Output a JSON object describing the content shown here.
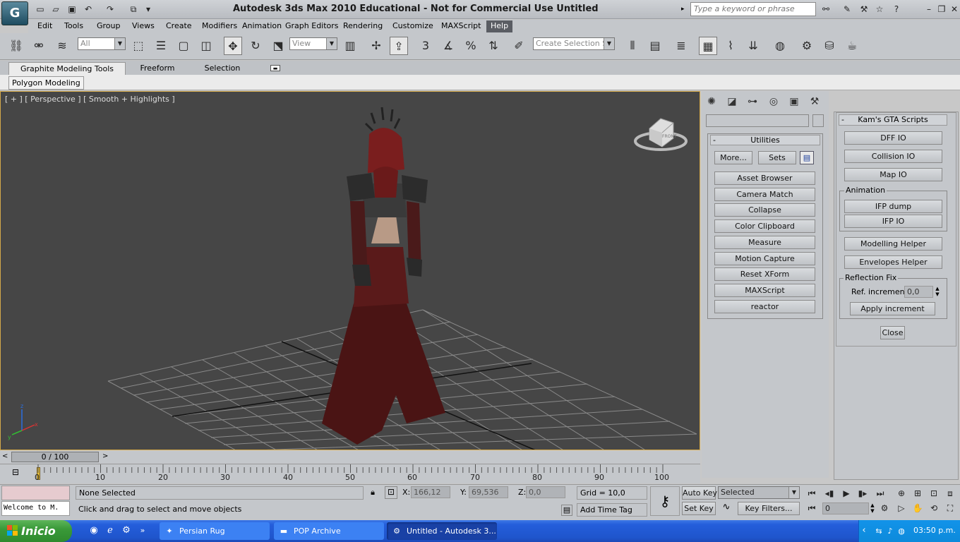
{
  "title": "Autodesk 3ds Max  2010    Educational - Not for Commercial Use    Untitled",
  "search_placeholder": "Type a keyword or phrase",
  "menu": [
    "Edit",
    "Tools",
    "Group",
    "Views",
    "Create",
    "Modifiers",
    "Animation",
    "Graph Editors",
    "Rendering",
    "Customize",
    "MAXScript",
    "Help"
  ],
  "toolbar": {
    "filter_value": "All",
    "refcoord_value": "View",
    "selection_set_value": "Create Selection Se",
    "snap_label": "3"
  },
  "ribbon": {
    "tabs": [
      "Graphite Modeling Tools",
      "Freeform",
      "Selection"
    ],
    "sub": "Polygon Modeling"
  },
  "viewport": {
    "label": "[ + ] [ Perspective ] [ Smooth + Highlights ]",
    "viewcube_face": "FRONT",
    "axis": {
      "x": "x",
      "y": "y",
      "z": "z"
    }
  },
  "utilities": {
    "header": "Utilities",
    "more": "More...",
    "sets": "Sets",
    "items": [
      "Asset Browser",
      "Camera Match",
      "Collapse",
      "Color Clipboard",
      "Measure",
      "Motion Capture",
      "Reset XForm",
      "MAXScript",
      "reactor"
    ]
  },
  "scripts": {
    "header": "Kam's GTA Scripts",
    "btn1": "DFF IO",
    "btn2": "Collision IO",
    "btn3": "Map IO",
    "anim_group": "Animation",
    "ifp_dump": "IFP dump",
    "ifp_io": "IFP IO",
    "modelling": "Modelling Helper",
    "envelopes": "Envelopes Helper",
    "refl_group": "Reflection Fix",
    "ref_inc_label": "Ref. increment",
    "ref_inc_value": "0,0",
    "apply": "Apply increment",
    "close": "Close"
  },
  "timeline": {
    "frame": "0 / 100",
    "ticks": [
      "0",
      "10",
      "20",
      "30",
      "40",
      "50",
      "60",
      "70",
      "80",
      "90",
      "100"
    ]
  },
  "status": {
    "selection": "None Selected",
    "prompt": "Click and drag to select and move objects",
    "maxscript": "Welcome to M.",
    "x_label": "X:",
    "x": "166,12",
    "y_label": "Y:",
    "y": "69,536",
    "z_label": "Z:",
    "z": "0,0",
    "grid": "Grid = 10,0",
    "add_tag": "Add Time Tag",
    "auto_key": "Auto Key",
    "set_key": "Set Key",
    "selected": "Selected",
    "key_filters": "Key Filters...",
    "frame_value": "0"
  },
  "taskbar": {
    "start": "Inicio",
    "tasks": [
      "Persian Rug",
      "POP Archive",
      "Untitled - Autodesk 3..."
    ],
    "clock": "03:50 p.m."
  }
}
